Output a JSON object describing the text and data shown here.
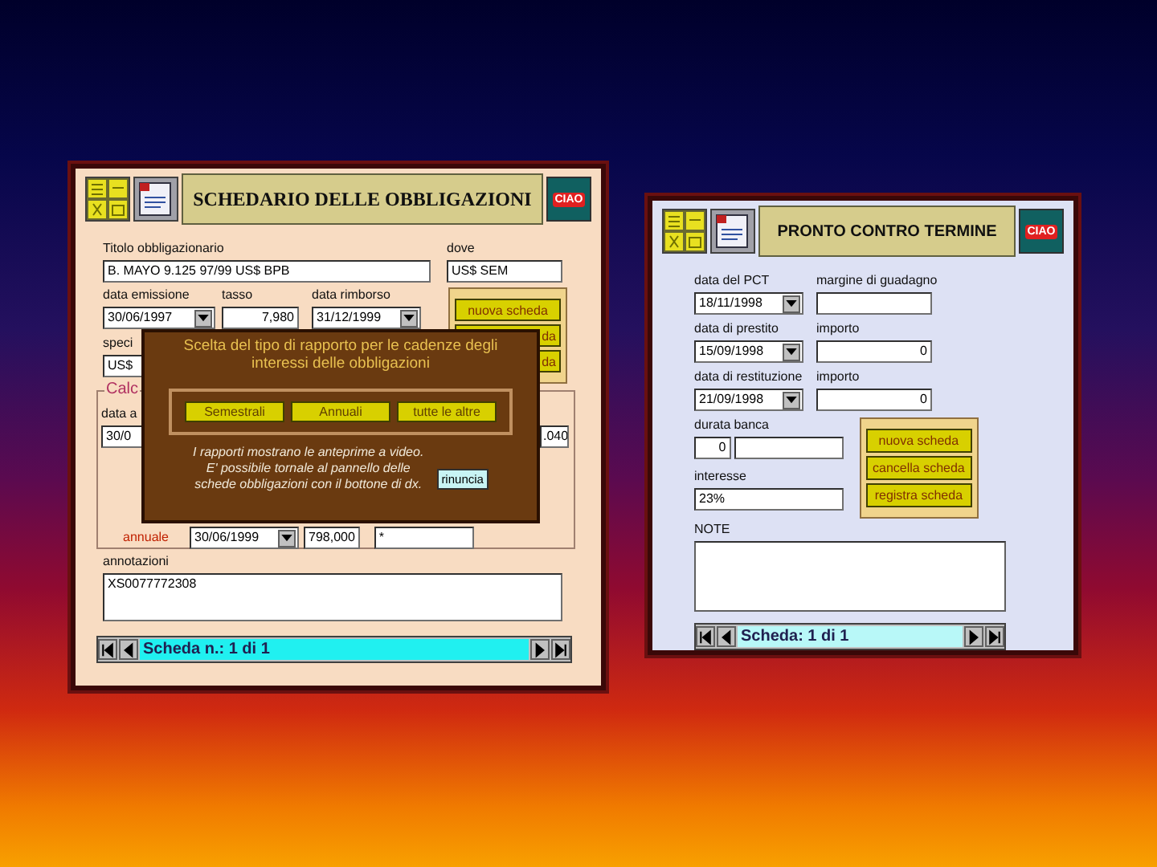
{
  "bond_window": {
    "title": "SCHEDARIO DELLE OBBLIGAZIONI",
    "logo_text": "CIAO",
    "titolo": {
      "label": "Titolo obbligazionario",
      "value": "B. MAYO 9.125 97/99  US$ BPB",
      "kind": "text"
    },
    "dove": {
      "label": "dove",
      "value": "US$ SEM",
      "kind": "text"
    },
    "row2": [
      {
        "label": "data emissione",
        "value": "30/06/1997",
        "kind": "dropdown"
      },
      {
        "label": "tasso",
        "value": "7,980",
        "kind": "number"
      },
      {
        "label": "data rimborso",
        "value": "31/12/1999",
        "kind": "dropdown"
      }
    ],
    "buttons": [
      "nuova scheda",
      "da",
      "da"
    ],
    "specie": {
      "label": "speci",
      "value": "US$",
      "kind": "text"
    },
    "group": {
      "legend": "Calc",
      "date_label": "data a",
      "date_value": "30/0",
      "right_value": ".040",
      "row_label": "annuale",
      "row_date": "30/06/1999",
      "row_amount": "798,000",
      "row_note": "*"
    },
    "annotazioni": {
      "label": "annotazioni",
      "value": "XS0077772308",
      "kind": "text"
    },
    "navigator": "Scheda n.: 1 di  1"
  },
  "dialog": {
    "title": "Scelta del tipo di rapporto per le cadenze degli interessi delle obbligazioni",
    "buttons": [
      "Semestrali",
      "Annuali",
      "tutte le altre"
    ],
    "note_lines": [
      "I rapporti mostrano le anteprime a video.",
      "E' possibile tornale al pannello delle",
      "schede obbligazioni con il bottone di dx."
    ],
    "cancel": "rinuncia"
  },
  "pct_window": {
    "title": "PRONTO CONTRO TERMINE",
    "logo_text": "CIAO",
    "rows": [
      [
        {
          "label": "data del PCT",
          "value": "18/11/1998",
          "kind": "dropdown"
        },
        {
          "label": "margine di guadagno",
          "kind": "text"
        }
      ],
      [
        {
          "label": "data di prestito",
          "value": "15/09/1998",
          "kind": "dropdown"
        },
        {
          "label": "importo",
          "value": "0",
          "kind": "number"
        }
      ],
      [
        {
          "label": "data di restituzione",
          "value": "21/09/1998",
          "kind": "dropdown"
        },
        {
          "label": "importo",
          "value": "0",
          "kind": "number"
        }
      ]
    ],
    "durata": {
      "label": "durata",
      "value": "0",
      "kind": "number"
    },
    "banca": {
      "label": "banca",
      "kind": "text"
    },
    "interesse": {
      "label": "interesse",
      "value": "23%",
      "kind": "text"
    },
    "note_label": "NOTE",
    "buttons": [
      "nuova scheda",
      "cancella scheda",
      "registra scheda"
    ],
    "navigator": "Scheda: 1 di 1"
  }
}
